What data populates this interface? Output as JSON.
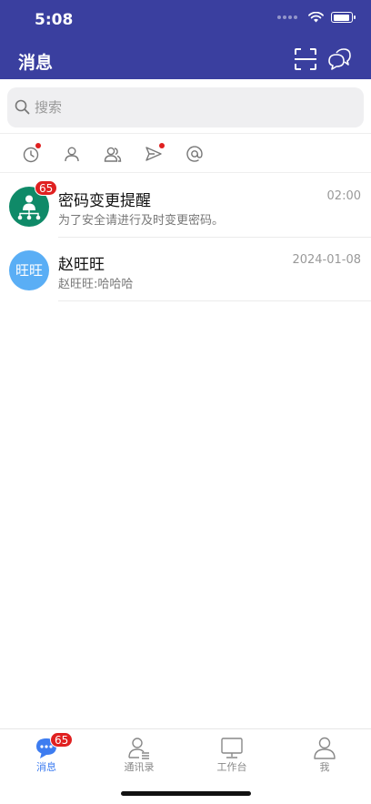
{
  "status_bar": {
    "time": "5:08"
  },
  "header": {
    "title": "消息",
    "scan_icon": "scan-icon",
    "chat_icon": "chat-bubbles-icon",
    "background_color": "#3a3f9f"
  },
  "search": {
    "placeholder": "搜索"
  },
  "filters": [
    {
      "icon": "clock-icon",
      "has_dot": true
    },
    {
      "icon": "person-icon",
      "has_dot": false
    },
    {
      "icon": "people-icon",
      "has_dot": false
    },
    {
      "icon": "send-icon",
      "has_dot": true
    },
    {
      "icon": "at-icon",
      "has_dot": false
    }
  ],
  "conversations": [
    {
      "name": "密码变更提醒",
      "preview": "为了安全请进行及时变更密码。",
      "time": "02:00",
      "badge": "65",
      "avatar_color": "#0f8a68",
      "avatar_icon": "org-chart-icon"
    },
    {
      "name": "赵旺旺",
      "preview": "赵旺旺:哈哈哈",
      "time": "2024-01-08",
      "avatar_text": "旺旺",
      "avatar_color": "#5aaef5"
    }
  ],
  "tabbar": {
    "tabs": [
      {
        "label": "消息",
        "icon": "message-icon",
        "active": true,
        "badge": "65"
      },
      {
        "label": "通讯录",
        "icon": "contacts-icon",
        "active": false
      },
      {
        "label": "工作台",
        "icon": "monitor-icon",
        "active": false
      },
      {
        "label": "我",
        "icon": "profile-icon",
        "active": false
      }
    ],
    "active_color": "#3d7cf0"
  }
}
